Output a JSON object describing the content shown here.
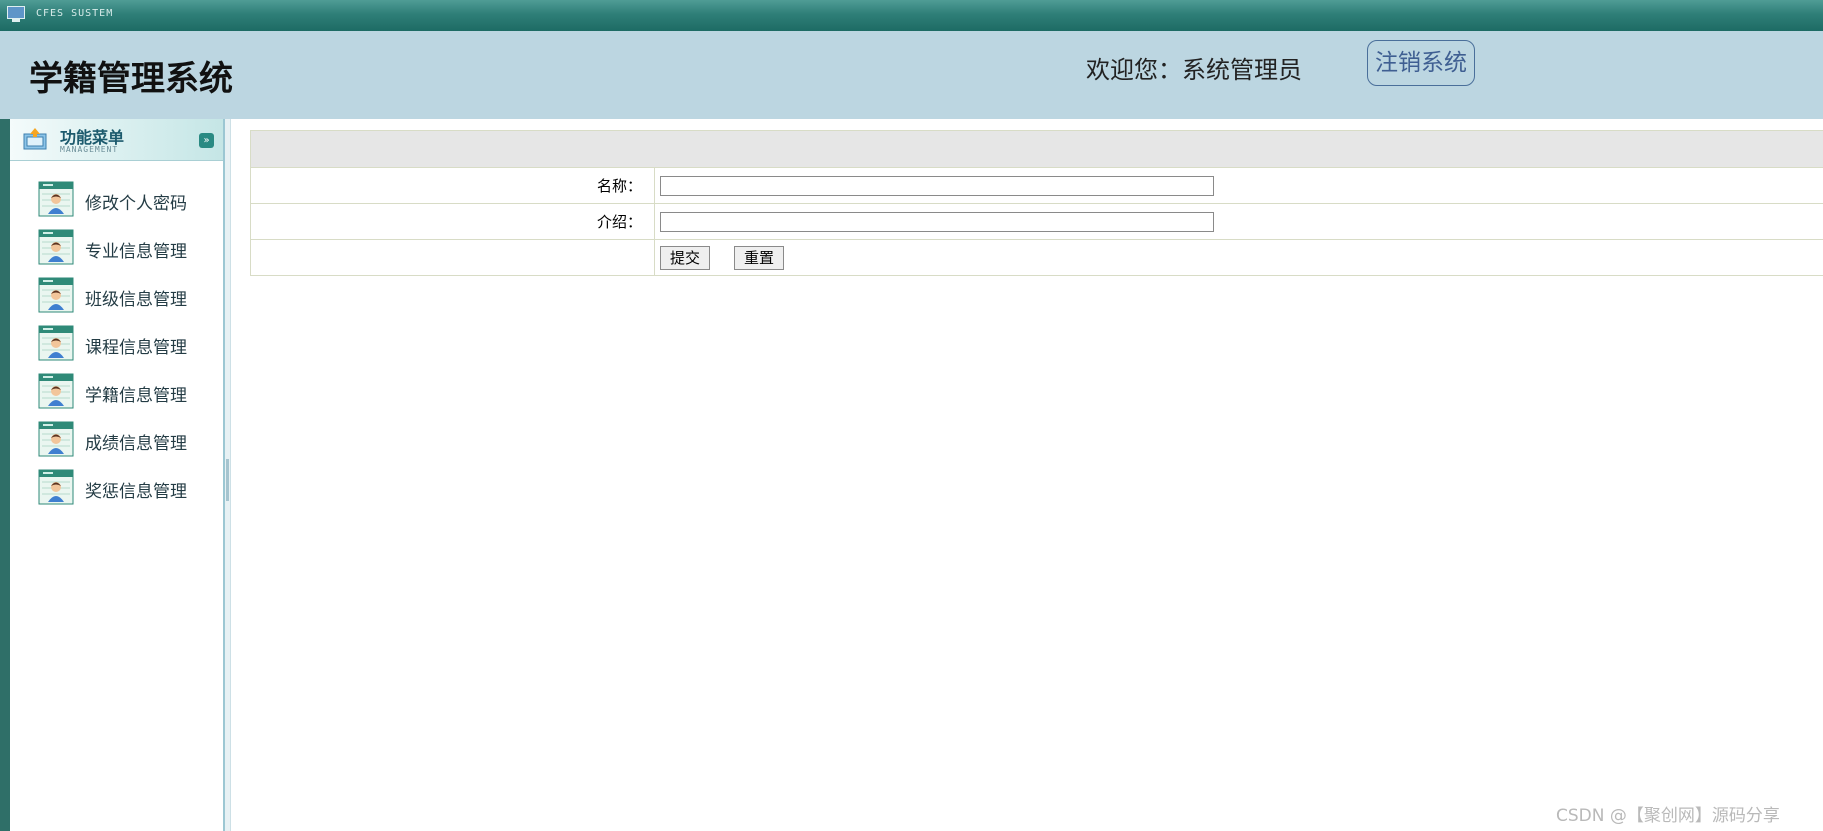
{
  "window": {
    "title": "CFES SUSTEM"
  },
  "header": {
    "app_title": "学籍管理系统",
    "welcome": "欢迎您：系统管理员",
    "logout_label": "注销系统"
  },
  "sidebar": {
    "menu_title": "功能菜单",
    "menu_subtitle": "MANAGEMENT",
    "items": [
      {
        "label": "修改个人密码",
        "icon": "user-card-icon"
      },
      {
        "label": "专业信息管理",
        "icon": "user-card-icon"
      },
      {
        "label": "班级信息管理",
        "icon": "user-card-icon"
      },
      {
        "label": "课程信息管理",
        "icon": "user-card-icon"
      },
      {
        "label": "学籍信息管理",
        "icon": "user-card-icon"
      },
      {
        "label": "成绩信息管理",
        "icon": "user-card-icon"
      },
      {
        "label": "奖惩信息管理",
        "icon": "user-card-icon"
      }
    ]
  },
  "form": {
    "fields": [
      {
        "label": "名称：",
        "value": ""
      },
      {
        "label": "介绍：",
        "value": ""
      }
    ],
    "submit_label": "提交",
    "reset_label": "重置"
  },
  "watermark": "CSDN @【聚创网】源码分享",
  "colors": {
    "topbar": "#1d6b64",
    "header_bg": "#bcd6e1",
    "logout_border": "#4a6f9a",
    "sidebar_strip": "#2f6f68",
    "form_head_bg": "#e6e6e6"
  }
}
